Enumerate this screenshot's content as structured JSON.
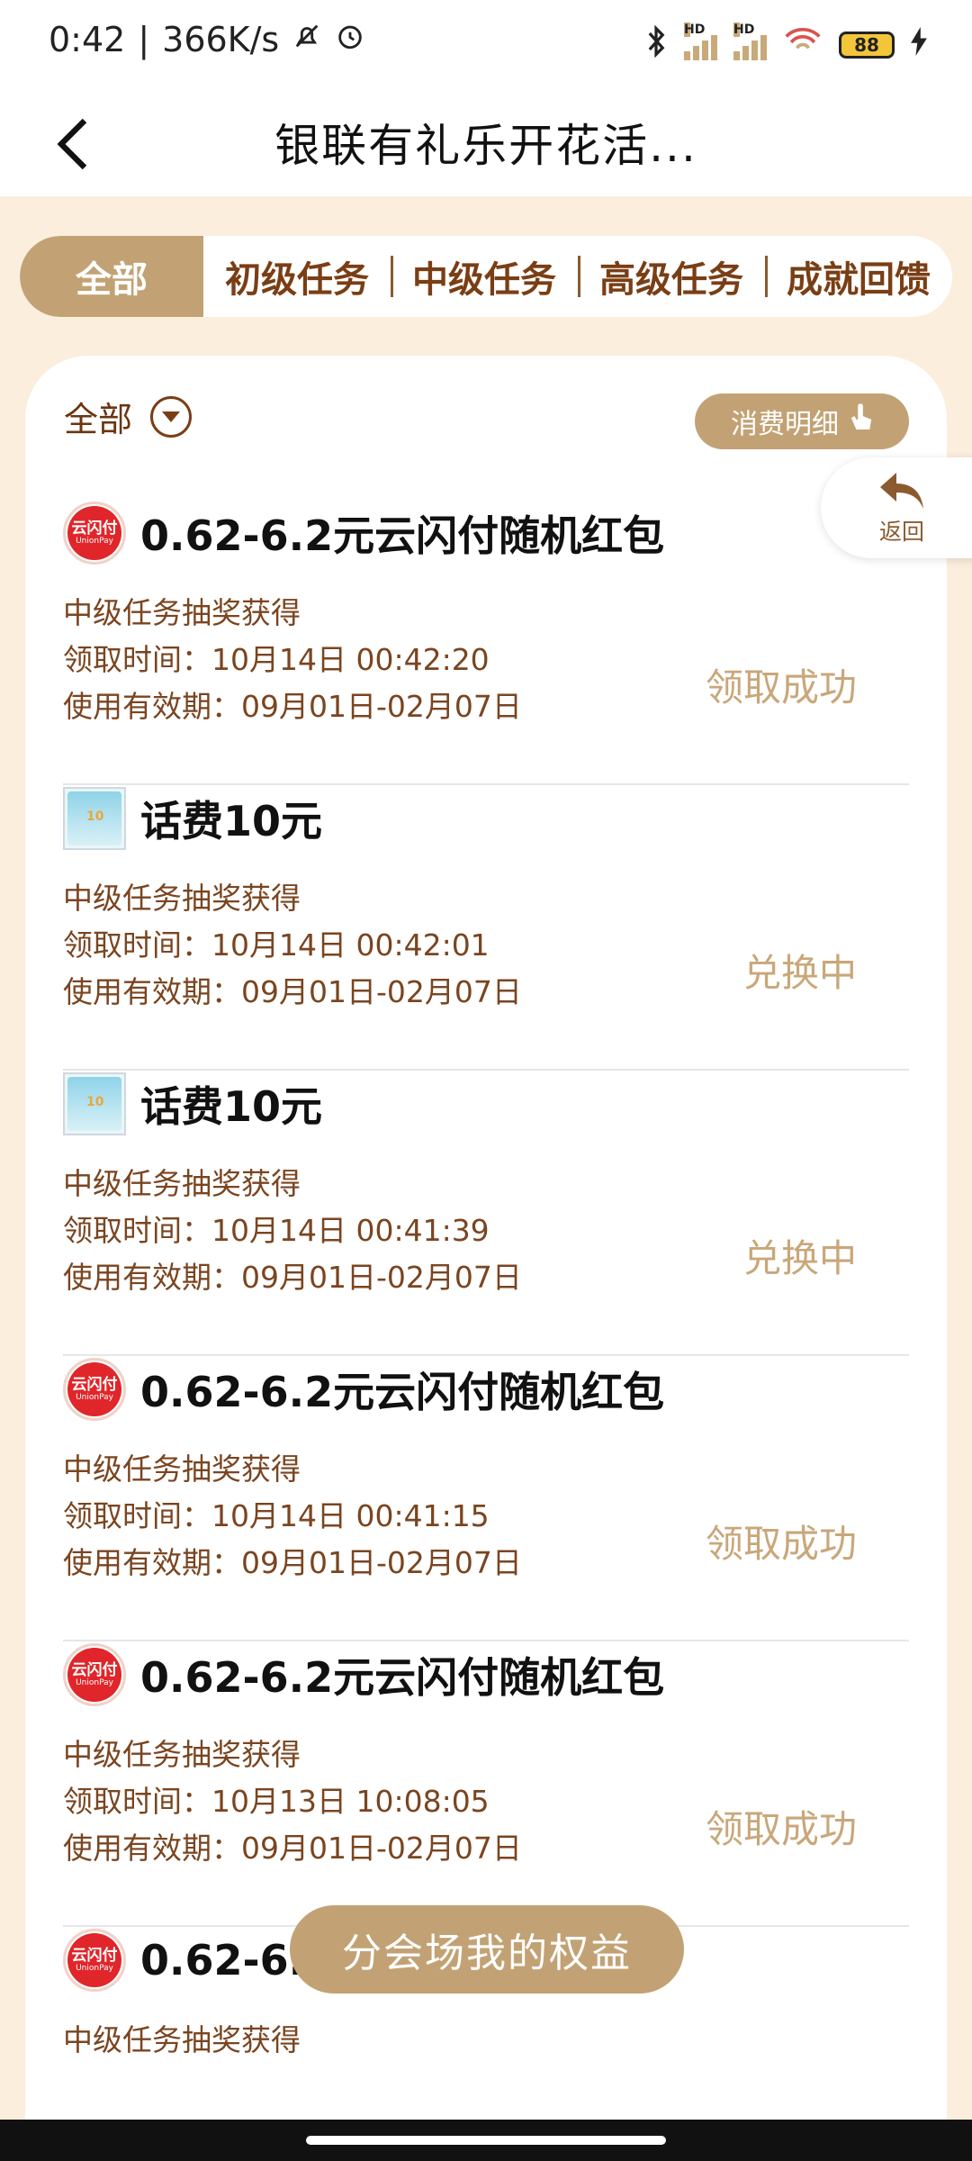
{
  "status_bar": {
    "time": "0:42",
    "speed": "366K/s",
    "battery": "88",
    "signal_labels": [
      "HD",
      "HD"
    ]
  },
  "nav": {
    "title": "银联有礼乐开花活..."
  },
  "tabs": [
    {
      "label": "全部",
      "active": true
    },
    {
      "label": "初级任务",
      "active": false
    },
    {
      "label": "中级任务",
      "active": false
    },
    {
      "label": "高级任务",
      "active": false
    },
    {
      "label": "成就回馈",
      "active": false
    }
  ],
  "filter": {
    "label": "全部",
    "spend_detail_label": "消费明细"
  },
  "side_return": {
    "label": "返回"
  },
  "items": [
    {
      "icon": "unionpay-logo",
      "logo_text": "云闪付",
      "logo_sub": "UnionPay",
      "title": "0.62-6.2元云闪付随机红包",
      "source": "中级任务抽奖获得",
      "claim_time": "领取时间：10月14日 00:42:20",
      "validity": "使用有效期：09月01日-02月07日",
      "status": "领取成功"
    },
    {
      "icon": "phone-credit-icon",
      "title": "话费10元",
      "source": "中级任务抽奖获得",
      "claim_time": "领取时间：10月14日 00:42:01",
      "validity": "使用有效期：09月01日-02月07日",
      "status": "兑换中"
    },
    {
      "icon": "phone-credit-icon",
      "title": "话费10元",
      "source": "中级任务抽奖获得",
      "claim_time": "领取时间：10月14日 00:41:39",
      "validity": "使用有效期：09月01日-02月07日",
      "status": "兑换中"
    },
    {
      "icon": "unionpay-logo",
      "logo_text": "云闪付",
      "logo_sub": "UnionPay",
      "title": "0.62-6.2元云闪付随机红包",
      "source": "中级任务抽奖获得",
      "claim_time": "领取时间：10月14日 00:41:15",
      "validity": "使用有效期：09月01日-02月07日",
      "status": "领取成功"
    },
    {
      "icon": "unionpay-logo",
      "logo_text": "云闪付",
      "logo_sub": "UnionPay",
      "title": "0.62-6.2元云闪付随机红包",
      "source": "中级任务抽奖获得",
      "claim_time": "领取时间：10月13日 10:08:05",
      "validity": "使用有效期：09月01日-02月07日",
      "status": "领取成功"
    },
    {
      "icon": "unionpay-logo",
      "logo_text": "云闪付",
      "logo_sub": "UnionPay",
      "title": "0.62-6.2",
      "source": "中级任务抽奖获得",
      "claim_time": "",
      "validity": "",
      "status": ""
    }
  ],
  "floating_button": {
    "label": "分会场我的权益"
  },
  "colors": {
    "accent_gold": "#c2a274",
    "status_gold": "#c9a77a",
    "brown_text": "#7a4520",
    "page_bg": "#fbeedc"
  }
}
